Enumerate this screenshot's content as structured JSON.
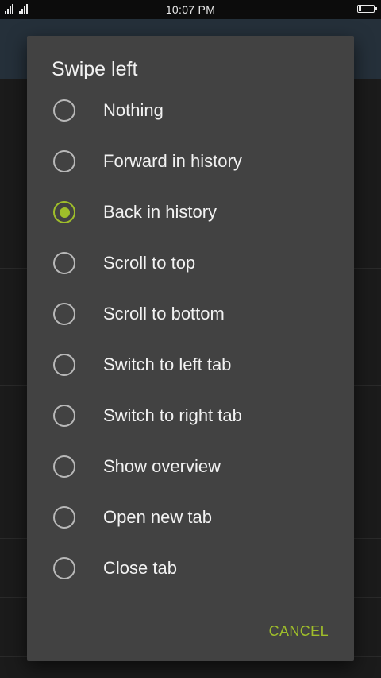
{
  "status_bar": {
    "time": "10:07 PM",
    "battery_level": 0.15
  },
  "dialog": {
    "title": "Swipe left",
    "selected_index": 2,
    "options": [
      {
        "label": "Nothing"
      },
      {
        "label": "Forward in history"
      },
      {
        "label": "Back in history"
      },
      {
        "label": "Scroll to top"
      },
      {
        "label": "Scroll to bottom"
      },
      {
        "label": "Switch to left tab"
      },
      {
        "label": "Switch to right tab"
      },
      {
        "label": "Show overview"
      },
      {
        "label": "Open new tab"
      },
      {
        "label": "Close tab"
      }
    ],
    "cancel_label": "CANCEL"
  },
  "colors": {
    "accent": "#9fbe2a",
    "dialog_bg": "#424242",
    "text": "#f2f2f2"
  },
  "icons": {
    "signal": "signal-strength-icon",
    "battery": "battery-icon",
    "radio_unchecked": "radio-unchecked-icon",
    "radio_checked": "radio-checked-icon"
  }
}
